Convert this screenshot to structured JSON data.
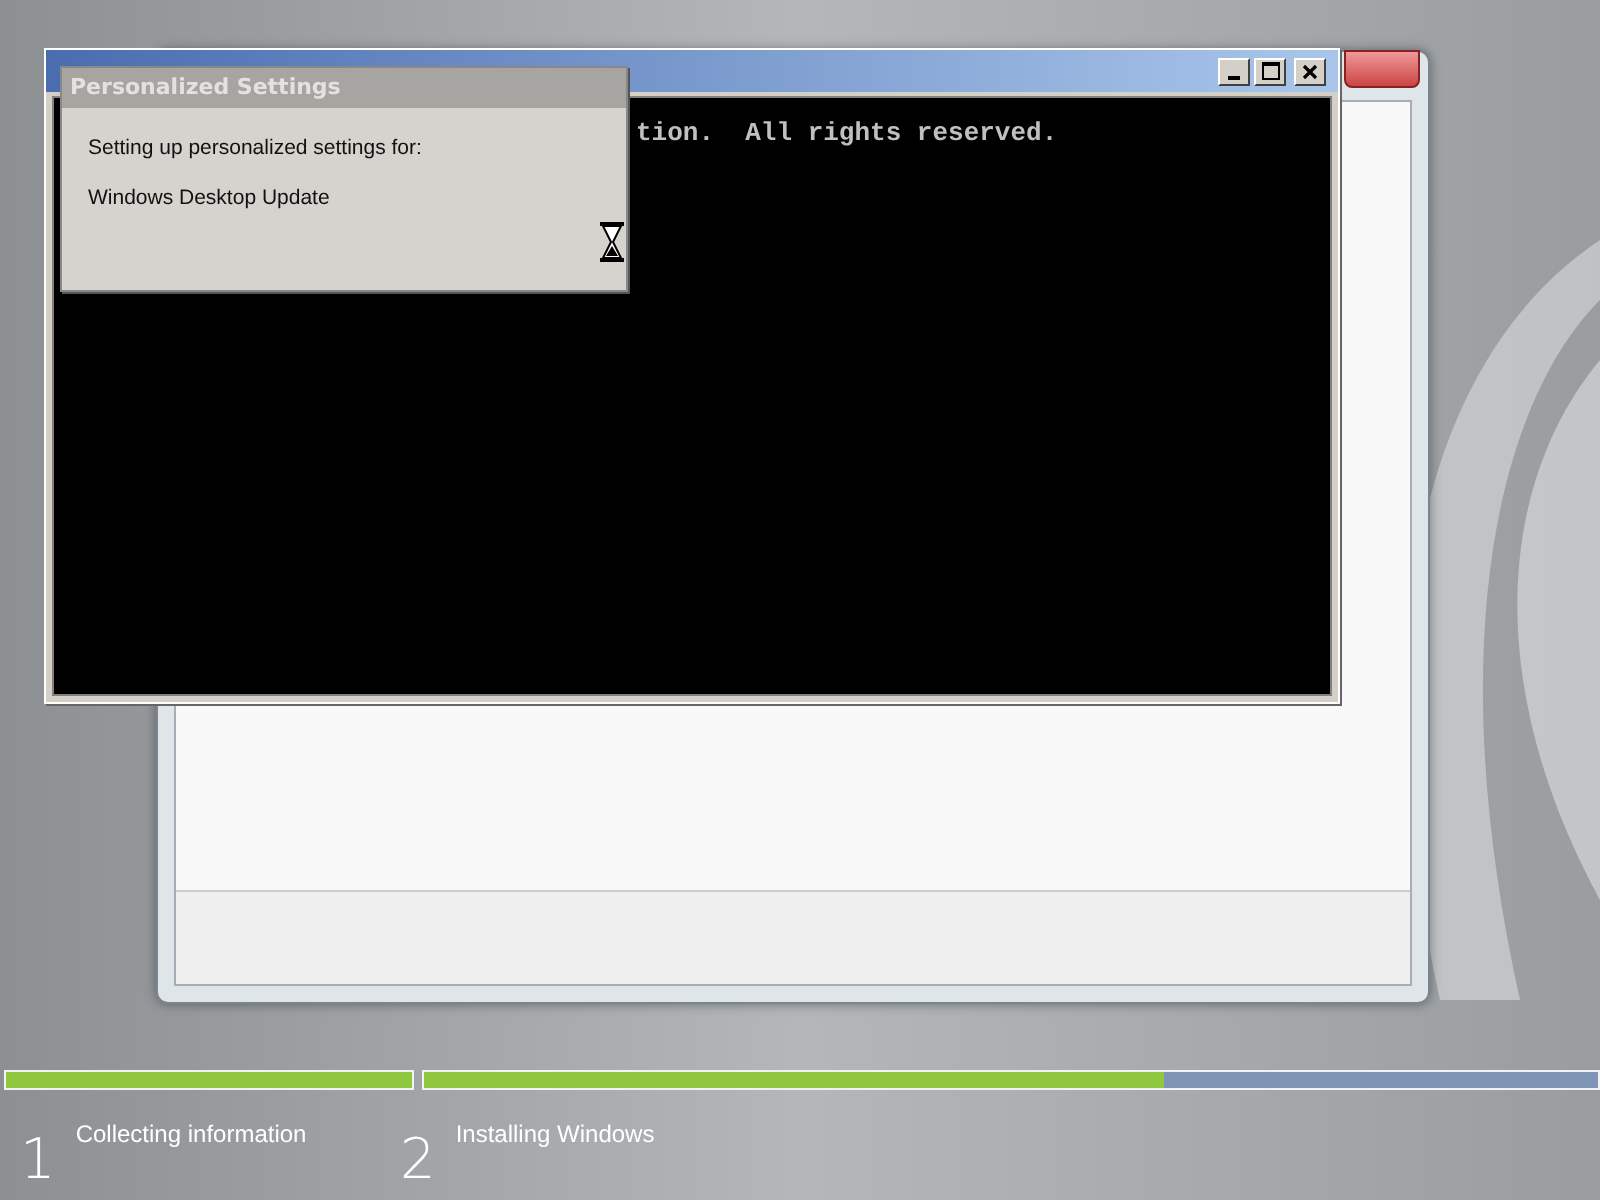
{
  "console_window": {
    "output_line": "tion.  All rights reserved."
  },
  "dialog": {
    "title": "Personalized Settings",
    "message": "Setting up personalized settings for:",
    "item": "Windows Desktop Update"
  },
  "steps": [
    {
      "number": "1",
      "label": "Collecting information",
      "level": 1
    },
    {
      "number": "2",
      "label": "Installing Windows",
      "level": 0.63
    }
  ]
}
